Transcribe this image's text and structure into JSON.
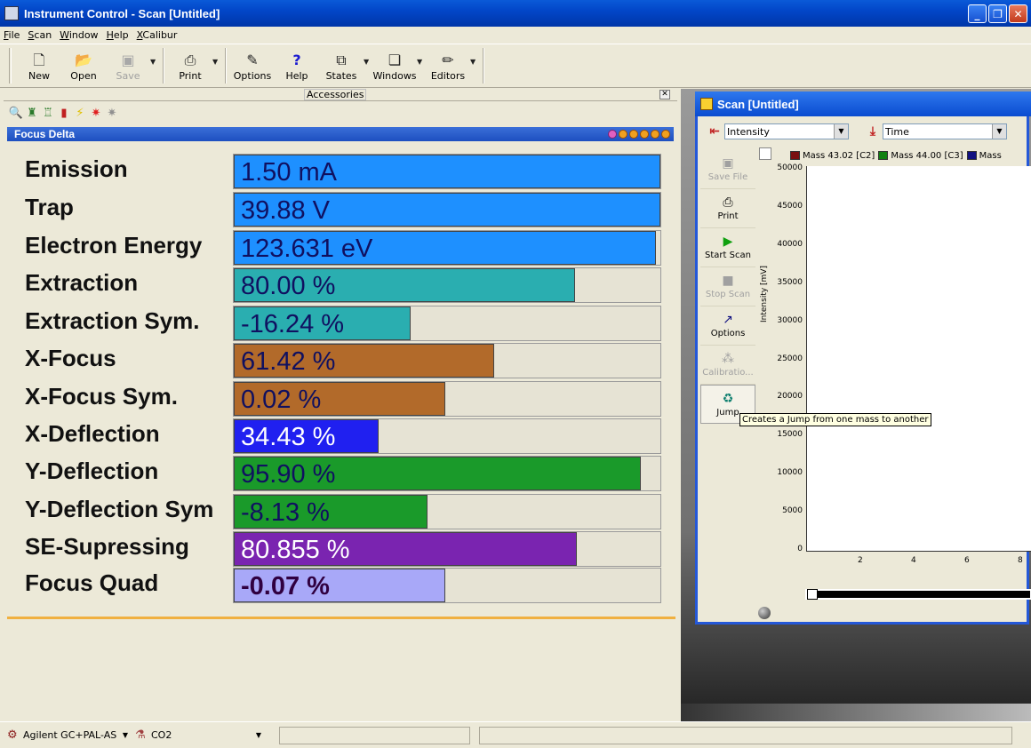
{
  "window": {
    "title": "Instrument Control - Scan [Untitled]"
  },
  "menu": [
    "File",
    "Scan",
    "Window",
    "Help",
    "XCalibur"
  ],
  "toolbar": {
    "new": "New",
    "open": "Open",
    "save": "Save",
    "print": "Print",
    "options": "Options",
    "help": "Help",
    "states": "States",
    "windows": "Windows",
    "editors": "Editors"
  },
  "accessories": {
    "title": "Accessories"
  },
  "focus_delta": {
    "title": "Focus Delta",
    "rows": [
      {
        "label": "Emission",
        "value": "1.50 mA",
        "level": 1.0,
        "color": "#1e90ff"
      },
      {
        "label": "Trap",
        "value": "39.88 V",
        "level": 1.0,
        "color": "#1e90ff"
      },
      {
        "label": "Electron Energy",
        "value": "123.631 eV",
        "level": 0.99,
        "color": "#1e90ff"
      },
      {
        "label": "Extraction",
        "value": "80.00 %",
        "level": 0.8,
        "color": "#2aaeb0"
      },
      {
        "label": "Extraction Sym.",
        "value": "-16.24 %",
        "level": 0.415,
        "color": "#2aaeb0"
      },
      {
        "label": "X-Focus",
        "value": "61.42 %",
        "level": 0.61,
        "color": "#b26a2a"
      },
      {
        "label": "X-Focus Sym.",
        "value": "0.02 %",
        "level": 0.495,
        "color": "#b26a2a"
      },
      {
        "label": "X-Deflection",
        "value": "34.43 %",
        "level": 0.34,
        "color": "#2020f0"
      },
      {
        "label": "Y-Deflection",
        "value": "95.90 %",
        "level": 0.955,
        "color": "#1a9a2a"
      },
      {
        "label": "Y-Deflection Sym",
        "value": "-8.13 %",
        "level": 0.455,
        "color": "#1a9a2a"
      },
      {
        "label": "SE-Supressing",
        "value": "80.855 %",
        "level": 0.805,
        "color": "#7a24b0"
      },
      {
        "label": "Focus Quad",
        "value": "-0.07 %",
        "level": 0.495,
        "color": "#a8a8f8"
      }
    ]
  },
  "scan": {
    "title": "Scan [Untitled]",
    "y_select": "Intensity",
    "x_select": "Time",
    "side_buttons": {
      "save_file": "Save File",
      "print": "Print",
      "start_scan": "Start Scan",
      "stop_scan": "Stop Scan",
      "options": "Options",
      "calibration": "Calibratio...",
      "jump": "Jump"
    },
    "tooltip": "Creates a Jump from one mass to another",
    "legend": [
      {
        "label": "Mass  43.02 [C2]",
        "color": "#7a1010"
      },
      {
        "label": "Mass  44.00 [C3]",
        "color": "#108010"
      },
      {
        "label": "Mass",
        "color": "#101080"
      }
    ],
    "chart_data": {
      "type": "line",
      "ylabel": "Intensity [mV]",
      "xlabel": "",
      "y_ticks": [
        "50000",
        "45000",
        "40000",
        "35000",
        "30000",
        "25000",
        "20000",
        "15000",
        "10000",
        "5000",
        "0"
      ],
      "x_ticks": [
        "2",
        "4",
        "6",
        "8"
      ],
      "ylim": [
        0,
        50000
      ],
      "series": []
    }
  },
  "status": {
    "instrument": "Agilent GC+PAL-AS",
    "gas": "CO2"
  }
}
